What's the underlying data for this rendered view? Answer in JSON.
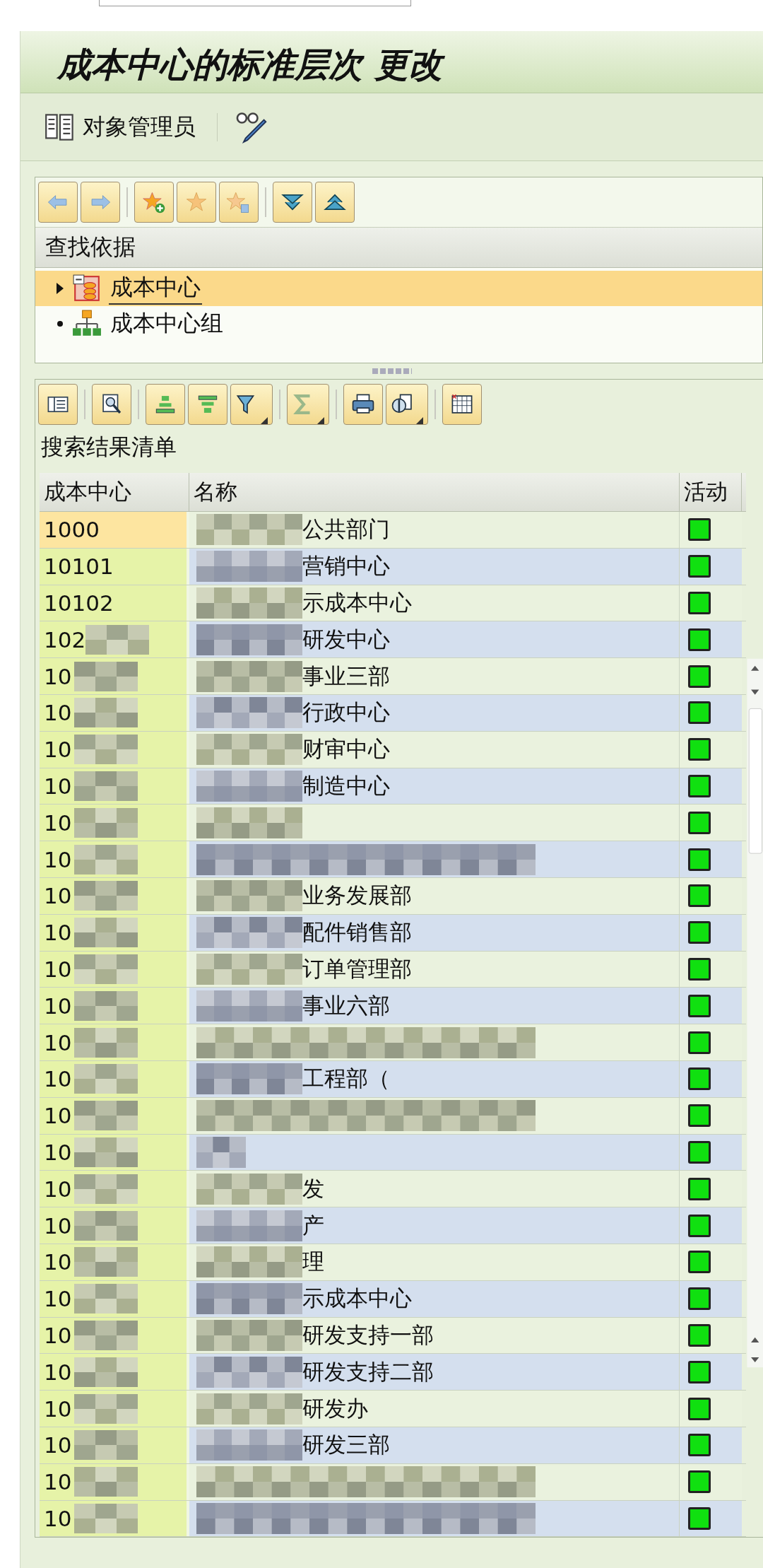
{
  "window": {
    "title": "成本中心的标准层次 更改"
  },
  "toolbar": {
    "label": "对象管理员"
  },
  "search_panel": {
    "title": "查找依据",
    "items": [
      {
        "label": "成本中心",
        "kind": "node",
        "selected": true
      },
      {
        "label": "成本中心组",
        "kind": "leaf",
        "selected": false
      }
    ]
  },
  "results": {
    "title": "搜索结果清单",
    "columns": [
      "成本中心",
      "名称",
      "活动"
    ],
    "rows": [
      {
        "code": "1000",
        "name": "公共部门",
        "selected": true,
        "active": true,
        "code_masked": false,
        "kind": "short"
      },
      {
        "code": "10101",
        "name": "营销中心",
        "selected": false,
        "active": true,
        "code_masked": false,
        "kind": "short"
      },
      {
        "code": "10102",
        "name": "示成本中心",
        "selected": false,
        "active": true,
        "code_masked": false,
        "kind": "short"
      },
      {
        "code": "102",
        "name": "研发中心",
        "selected": false,
        "active": true,
        "code_masked": true,
        "kind": "short"
      },
      {
        "code": "10",
        "name": "事业三部",
        "selected": false,
        "active": true,
        "code_masked": true,
        "kind": "short"
      },
      {
        "code": "10",
        "name": "行政中心",
        "selected": false,
        "active": true,
        "code_masked": true,
        "kind": "short"
      },
      {
        "code": "10",
        "name": "财审中心",
        "selected": false,
        "active": true,
        "code_masked": true,
        "kind": "short"
      },
      {
        "code": "10",
        "name": "制造中心",
        "selected": false,
        "active": true,
        "code_masked": true,
        "kind": "short"
      },
      {
        "code": "10",
        "selected": false,
        "active": true,
        "code_masked": true,
        "kind": "short"
      },
      {
        "code": "10",
        "selected": false,
        "active": true,
        "code_masked": true,
        "kind": "long"
      },
      {
        "code": "10",
        "name": "业务发展部",
        "selected": false,
        "active": true,
        "code_masked": true,
        "kind": "short"
      },
      {
        "code": "10",
        "name": "配件销售部",
        "selected": false,
        "active": true,
        "code_masked": true,
        "kind": "short"
      },
      {
        "code": "10",
        "name": "订单管理部",
        "selected": false,
        "active": true,
        "code_masked": true,
        "kind": "short"
      },
      {
        "code": "10",
        "name": "事业六部",
        "selected": false,
        "active": true,
        "code_masked": true,
        "kind": "short"
      },
      {
        "code": "10",
        "selected": false,
        "active": true,
        "code_masked": true,
        "kind": "long"
      },
      {
        "code": "10",
        "name": "工程部（",
        "selected": false,
        "active": true,
        "code_masked": true,
        "kind": "short"
      },
      {
        "code": "10",
        "selected": false,
        "active": true,
        "code_masked": true,
        "kind": "long"
      },
      {
        "code": "10",
        "selected": false,
        "active": true,
        "code_masked": true,
        "kind": "tiny"
      },
      {
        "code": "10",
        "name": "发",
        "selected": false,
        "active": true,
        "code_masked": true,
        "kind": "short"
      },
      {
        "code": "10",
        "name": "产",
        "selected": false,
        "active": true,
        "code_masked": true,
        "kind": "short"
      },
      {
        "code": "10",
        "name": "理",
        "selected": false,
        "active": true,
        "code_masked": true,
        "kind": "short"
      },
      {
        "code": "10",
        "name": "示成本中心",
        "selected": false,
        "active": true,
        "code_masked": true,
        "kind": "short"
      },
      {
        "code": "10",
        "name": "研发支持一部",
        "selected": false,
        "active": true,
        "code_masked": true,
        "kind": "short"
      },
      {
        "code": "10",
        "name": "研发支持二部",
        "selected": false,
        "active": true,
        "code_masked": true,
        "kind": "short"
      },
      {
        "code": "10",
        "name": "研发办",
        "selected": false,
        "active": true,
        "code_masked": true,
        "kind": "short"
      },
      {
        "code": "10",
        "name": "研发三部",
        "selected": false,
        "active": true,
        "code_masked": true,
        "kind": "short"
      },
      {
        "code": "10",
        "selected": false,
        "active": true,
        "code_masked": true,
        "kind": "long"
      },
      {
        "code": "10",
        "selected": false,
        "active": true,
        "code_masked": true,
        "kind": "long"
      }
    ]
  }
}
